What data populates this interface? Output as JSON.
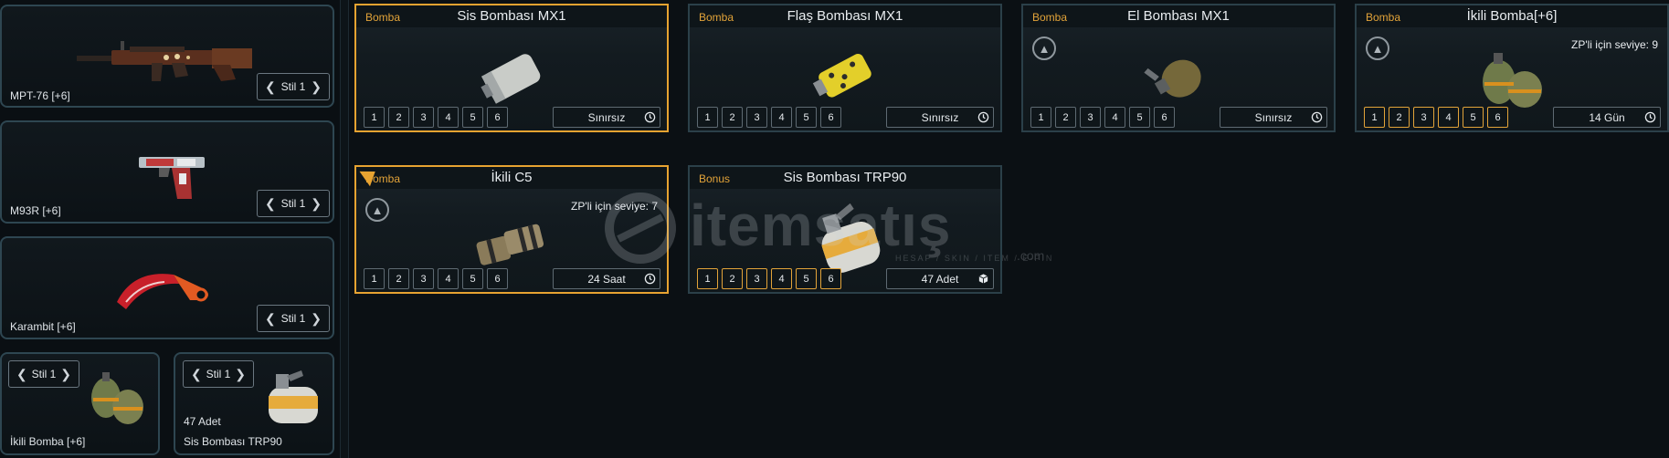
{
  "loadout": {
    "slots": [
      {
        "label": "MPT-76 [+6]",
        "style": "Stil 1",
        "icon": "rifle-icon"
      },
      {
        "label": "M93R [+6]",
        "style": "Stil 1",
        "icon": "pistol-icon"
      },
      {
        "label": "Karambit [+6]",
        "style": "Stil 1",
        "icon": "knife-icon"
      },
      {
        "label": "İkili Bomba [+6]",
        "style": "Stil 1",
        "icon": "twin-grenade-icon"
      },
      {
        "label": "Sis Bombası TRP90",
        "style": "Stil 1",
        "count": "47 Adet",
        "icon": "smoke-grenade-icon"
      }
    ]
  },
  "cards": [
    {
      "category": "Bomba",
      "title": "Sis Bombası MX1",
      "levels": [
        "1",
        "2",
        "3",
        "4",
        "5",
        "6"
      ],
      "duration": "Sınırsız",
      "selected": true
    },
    {
      "category": "Bomba",
      "title": "Flaş Bombası MX1",
      "levels": [
        "1",
        "2",
        "3",
        "4",
        "5",
        "6"
      ],
      "duration": "Sınırsız"
    },
    {
      "category": "Bomba",
      "title": "El Bombası MX1",
      "levels": [
        "1",
        "2",
        "3",
        "4",
        "5",
        "6"
      ],
      "duration": "Sınırsız"
    },
    {
      "category": "Bomba",
      "title": "İkili Bomba[+6]",
      "level_text": "ZP'li için seviye: 9",
      "levels": [
        "1",
        "2",
        "3",
        "4",
        "5",
        "6"
      ],
      "duration": "14 Gün"
    },
    {
      "category": "Bomba",
      "title": "İkili C5",
      "level_text": "ZP'li için seviye: 7",
      "levels": [
        "1",
        "2",
        "3",
        "4",
        "5",
        "6"
      ],
      "duration": "24 Saat",
      "selected": true
    },
    {
      "category": "Bonus",
      "title": "Sis Bombası TRP90",
      "levels": [
        "1",
        "2",
        "3",
        "4",
        "5",
        "6"
      ],
      "duration": "47 Adet"
    }
  ],
  "watermark": {
    "brand": "itemsatış",
    "tagline": "HESAP / SKIN / ITEM / E-PIN",
    "suffix": ".com"
  },
  "colors": {
    "accent": "#e7a331",
    "border": "#2b4049",
    "background": "#0b1014"
  }
}
